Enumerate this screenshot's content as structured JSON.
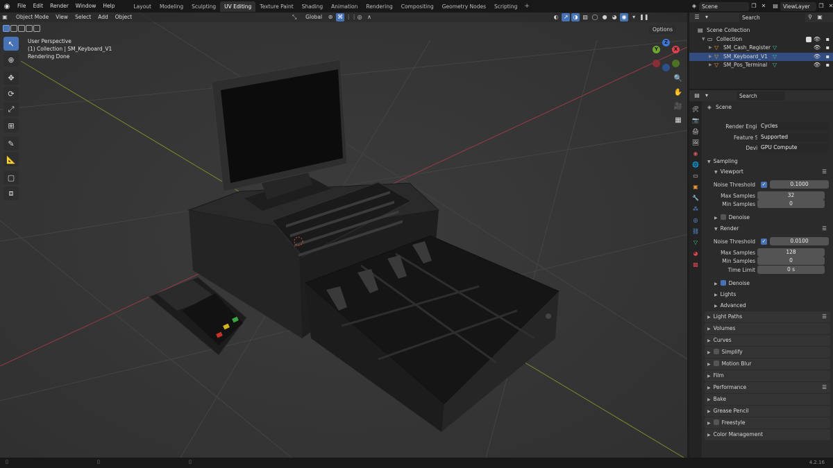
{
  "menu": [
    "File",
    "Edit",
    "Render",
    "Window",
    "Help"
  ],
  "workspaces": [
    "Layout",
    "Modeling",
    "Sculpting",
    "UV Editing",
    "Texture Paint",
    "Shading",
    "Animation",
    "Rendering",
    "Compositing",
    "Geometry Nodes",
    "Scripting"
  ],
  "active_workspace_index": 3,
  "scene_name": "Scene",
  "view_layer": "ViewLayer",
  "viewport_header": {
    "mode": "Object Mode",
    "menus": [
      "View",
      "Select",
      "Add",
      "Object"
    ],
    "orientation": "Global",
    "options_label": "Options"
  },
  "viewport_overlay": {
    "line1": "User Perspective",
    "line2": "(1) Collection | SM_Keyboard_V1",
    "line3": "Rendering Done"
  },
  "gizmo": {
    "x": "X",
    "y": "Y",
    "z": "Z"
  },
  "outliner": {
    "search_placeholder": "Search",
    "root": "Scene Collection",
    "collection": "Collection",
    "objects": [
      "SM_Cash_Register",
      "SM_Keyboard_V1",
      "SM_Pos_Terminal"
    ],
    "selected_index": 1
  },
  "properties": {
    "search_placeholder": "Search",
    "context": "Scene",
    "render_engine_label": "Render Engine",
    "render_engine": "Cycles",
    "feature_set_label": "Feature Set",
    "feature_set": "Supported",
    "device_label": "Device",
    "device": "GPU Compute",
    "sampling": "Sampling",
    "viewport": "Viewport",
    "noise_threshold_label": "Noise Threshold",
    "viewport_noise_threshold": "0.1000",
    "max_samples_label": "Max Samples",
    "viewport_max_samples": "32",
    "min_samples_label": "Min Samples",
    "viewport_min_samples": "0",
    "denoise": "Denoise",
    "render": "Render",
    "render_noise_threshold": "0.0100",
    "render_max_samples": "128",
    "render_min_samples": "0",
    "time_limit_label": "Time Limit",
    "time_limit": "0 s",
    "lights": "Lights",
    "advanced": "Advanced",
    "panels": [
      "Light Paths",
      "Volumes",
      "Curves",
      "Simplify",
      "Motion Blur",
      "Film",
      "Performance",
      "Bake",
      "Grease Pencil",
      "Freestyle",
      "Color Management"
    ]
  },
  "version": "4.2.16"
}
